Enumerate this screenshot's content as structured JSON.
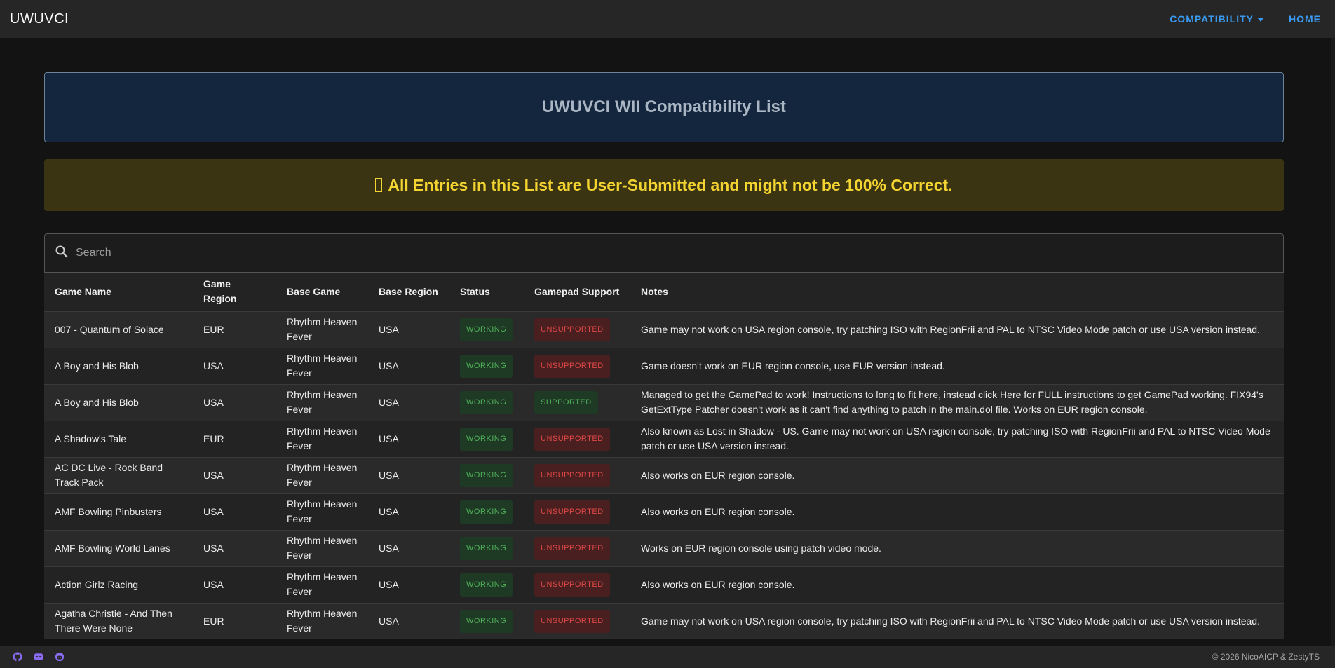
{
  "app": {
    "brand": "UWUVCI"
  },
  "nav": {
    "compatibility": "COMPATIBILITY",
    "home": "HOME"
  },
  "page": {
    "title": "UWUVCI WII Compatibility List",
    "warning_icon": "",
    "warning": "All Entries in this List are User-Submitted and might not be 100% Correct."
  },
  "search": {
    "placeholder": "Search",
    "value": ""
  },
  "table": {
    "headers": {
      "game_name": "Game Name",
      "game_region": "Game Region",
      "base_game": "Base Game",
      "base_region": "Base Region",
      "status": "Status",
      "gamepad": "Gamepad Support",
      "notes": "Notes"
    },
    "rows": [
      {
        "name": "007 - Quantum of Solace",
        "region": "EUR",
        "base": "Rhythm Heaven Fever",
        "base_region": "USA",
        "status": "WORKING",
        "gamepad": "UNSUPPORTED",
        "notes": "Game may not work on USA region console, try patching ISO with RegionFrii and PAL to NTSC Video Mode patch or use USA version instead."
      },
      {
        "name": "A Boy and His Blob",
        "region": "USA",
        "base": "Rhythm Heaven Fever",
        "base_region": "USA",
        "status": "WORKING",
        "gamepad": "UNSUPPORTED",
        "notes": "Game doesn't work on EUR region console, use EUR version instead."
      },
      {
        "name": "A Boy and His Blob",
        "region": "USA",
        "base": "Rhythm Heaven Fever",
        "base_region": "USA",
        "status": "WORKING",
        "gamepad": "SUPPORTED",
        "notes": "Managed to get the GamePad to work! Instructions to long to fit here, instead click Here for FULL instructions to get GamePad working. FIX94's GetExtType Patcher doesn't work as it can't find anything to patch in the main.dol file. Works on EUR region console."
      },
      {
        "name": "A Shadow's Tale",
        "region": "EUR",
        "base": "Rhythm Heaven Fever",
        "base_region": "USA",
        "status": "WORKING",
        "gamepad": "UNSUPPORTED",
        "notes": "Also known as Lost in Shadow - US. Game may not work on USA region console, try patching ISO with RegionFrii and PAL to NTSC Video Mode patch or use USA version instead."
      },
      {
        "name": "AC DC Live - Rock Band Track Pack",
        "region": "USA",
        "base": "Rhythm Heaven Fever",
        "base_region": "USA",
        "status": "WORKING",
        "gamepad": "UNSUPPORTED",
        "notes": "Also works on EUR region console."
      },
      {
        "name": "AMF Bowling Pinbusters",
        "region": "USA",
        "base": "Rhythm Heaven Fever",
        "base_region": "USA",
        "status": "WORKING",
        "gamepad": "UNSUPPORTED",
        "notes": "Also works on EUR region console."
      },
      {
        "name": "AMF Bowling World Lanes",
        "region": "USA",
        "base": "Rhythm Heaven Fever",
        "base_region": "USA",
        "status": "WORKING",
        "gamepad": "UNSUPPORTED",
        "notes": "Works on EUR region console using patch video mode."
      },
      {
        "name": "Action Girlz Racing",
        "region": "USA",
        "base": "Rhythm Heaven Fever",
        "base_region": "USA",
        "status": "WORKING",
        "gamepad": "UNSUPPORTED",
        "notes": "Also works on EUR region console."
      },
      {
        "name": "Agatha Christie - And Then There Were None",
        "region": "EUR",
        "base": "Rhythm Heaven Fever",
        "base_region": "USA",
        "status": "WORKING",
        "gamepad": "UNSUPPORTED",
        "notes": "Game may not work on USA region console, try patching ISO with RegionFrii and PAL to NTSC Video Mode patch or use USA version instead."
      }
    ]
  },
  "footer": {
    "icons": [
      "github-icon",
      "discord-icon",
      "reddit-icon"
    ],
    "copyright": "© 2026 NicoAICP & ZestyTS"
  },
  "colors": {
    "accent": "#3a9bf2",
    "warning": "#f3d431",
    "working": "#4fb05a",
    "unsupported": "#e04848",
    "social": "#8a6cf0"
  }
}
